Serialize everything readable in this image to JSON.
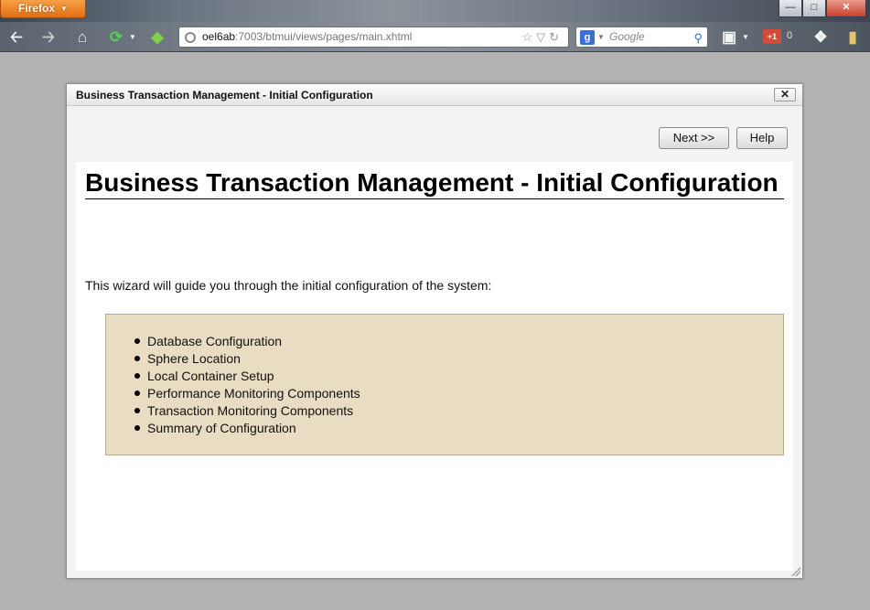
{
  "browser": {
    "app_button_label": "Firefox",
    "url_host": "oel6ab",
    "url_path": ":7003/btmui/views/pages/main.xhtml",
    "search_placeholder": "Google",
    "gplus_label": "+1",
    "gplus_count": "0"
  },
  "dialog": {
    "title": "Business Transaction Management - Initial Configuration",
    "close_label": "✕",
    "next_label": "Next >>",
    "help_label": "Help",
    "heading": "Business Transaction Management - Initial Configuration",
    "intro": "This wizard will guide you through the initial configuration of the system:",
    "steps": [
      "Database Configuration",
      "Sphere Location",
      "Local Container Setup",
      "Performance Monitoring Components",
      "Transaction Monitoring Components",
      "Summary of Configuration"
    ]
  },
  "colors": {
    "steps_background": "#e8dcc2",
    "firefox_orange": "#e26e12"
  }
}
